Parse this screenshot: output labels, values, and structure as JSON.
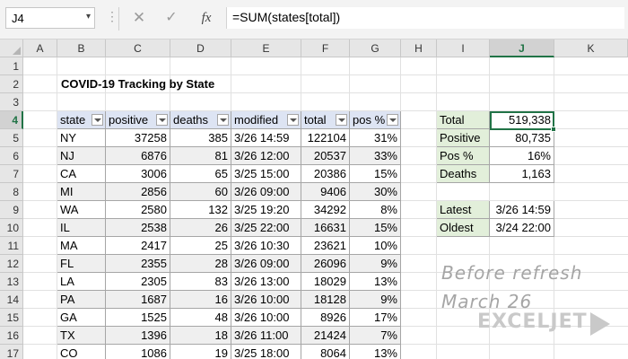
{
  "formula_bar": {
    "name_box": "J4",
    "name_box_arrow": "▾",
    "menu_dots": "⋮",
    "cancel_glyph": "✕",
    "enter_glyph": "✓",
    "fx_label": "fx",
    "formula": "=SUM(states[total])"
  },
  "columns": [
    "A",
    "B",
    "C",
    "D",
    "E",
    "F",
    "G",
    "H",
    "I",
    "J",
    "K"
  ],
  "rows": [
    "1",
    "2",
    "3",
    "4",
    "5",
    "6",
    "7",
    "8",
    "9",
    "10",
    "11",
    "12",
    "13",
    "14",
    "15",
    "16",
    "17"
  ],
  "selected_column": "J",
  "selected_row": "4",
  "title": "COVID-19 Tracking by State",
  "table": {
    "headers": [
      "state",
      "positive",
      "deaths",
      "modified",
      "total",
      "pos %"
    ],
    "rows": [
      [
        "NY",
        "37258",
        "385",
        "3/26 14:59",
        "122104",
        "31%"
      ],
      [
        "NJ",
        "6876",
        "81",
        "3/26 12:00",
        "20537",
        "33%"
      ],
      [
        "CA",
        "3006",
        "65",
        "3/25 15:00",
        "20386",
        "15%"
      ],
      [
        "MI",
        "2856",
        "60",
        "3/26 09:00",
        "9406",
        "30%"
      ],
      [
        "WA",
        "2580",
        "132",
        "3/25 19:20",
        "34292",
        "8%"
      ],
      [
        "IL",
        "2538",
        "26",
        "3/25 22:00",
        "16631",
        "15%"
      ],
      [
        "MA",
        "2417",
        "25",
        "3/26 10:30",
        "23621",
        "10%"
      ],
      [
        "FL",
        "2355",
        "28",
        "3/26 09:00",
        "26096",
        "9%"
      ],
      [
        "LA",
        "2305",
        "83",
        "3/26 13:00",
        "18029",
        "13%"
      ],
      [
        "PA",
        "1687",
        "16",
        "3/26 10:00",
        "18128",
        "9%"
      ],
      [
        "GA",
        "1525",
        "48",
        "3/26 10:00",
        "8926",
        "17%"
      ],
      [
        "TX",
        "1396",
        "18",
        "3/26 11:00",
        "21424",
        "7%"
      ],
      [
        "CO",
        "1086",
        "19",
        "3/25 18:00",
        "8064",
        "13%"
      ]
    ]
  },
  "summary": [
    {
      "label": "Total",
      "value": "519,338"
    },
    {
      "label": "Positive",
      "value": "80,735"
    },
    {
      "label": "Pos %",
      "value": "16%"
    },
    {
      "label": "Deaths",
      "value": "1,163"
    }
  ],
  "dates": [
    {
      "label": "Latest",
      "value": "3/26 14:59"
    },
    {
      "label": "Oldest",
      "value": "3/24 22:00"
    }
  ],
  "note": {
    "line1": "Before refresh",
    "line2": "March 26"
  },
  "logo": {
    "text": "EXCELJET"
  },
  "colors": {
    "accent": "#217346",
    "table_header": "#dde4f3",
    "zebra": "#efefef",
    "summary_label": "#e2efda"
  }
}
